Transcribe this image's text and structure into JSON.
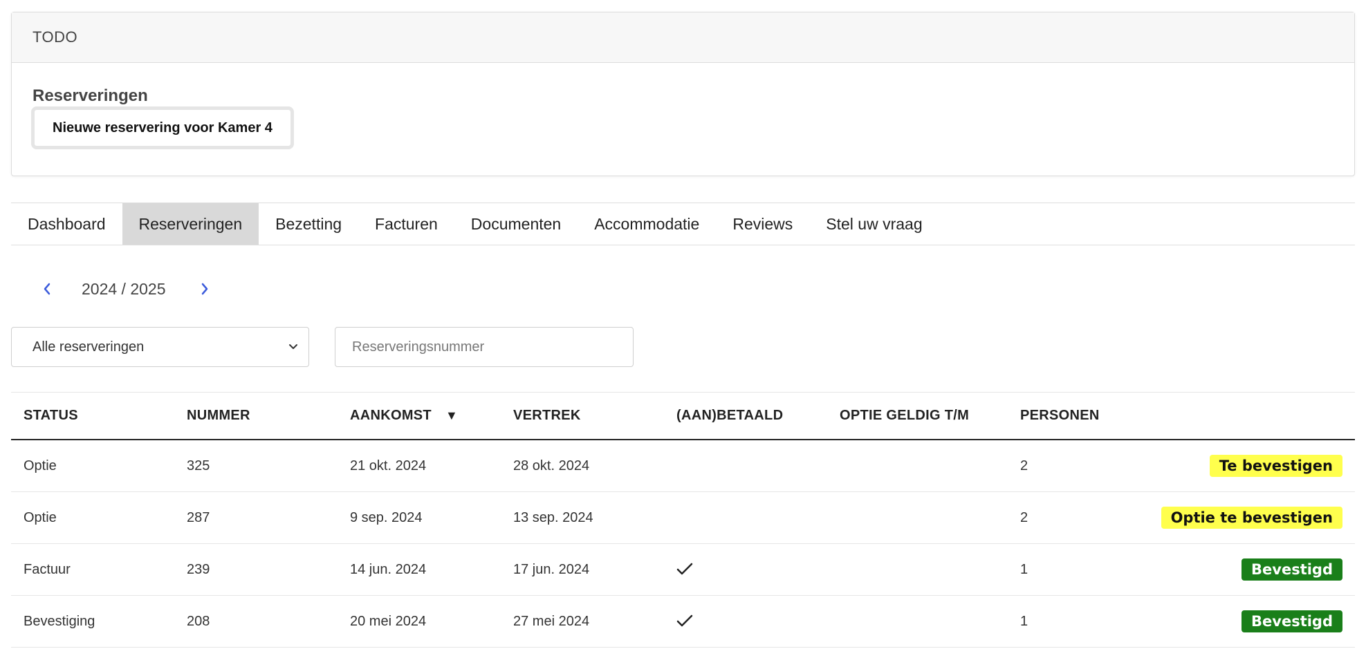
{
  "todo": {
    "header": "TODO",
    "section_title": "Reserveringen",
    "item_label": "Nieuwe reservering voor Kamer 4"
  },
  "tabs": [
    {
      "label": "Dashboard",
      "active": false
    },
    {
      "label": "Reserveringen",
      "active": true
    },
    {
      "label": "Bezetting",
      "active": false
    },
    {
      "label": "Facturen",
      "active": false
    },
    {
      "label": "Documenten",
      "active": false
    },
    {
      "label": "Accommodatie",
      "active": false
    },
    {
      "label": "Reviews",
      "active": false
    },
    {
      "label": "Stel uw vraag",
      "active": false
    }
  ],
  "year_nav": {
    "label": "2024 / 2025",
    "accent_color": "#3b5bdb"
  },
  "filter": {
    "selected": "Alle reserveringen"
  },
  "search": {
    "placeholder": "Reserveringsnummer",
    "value": ""
  },
  "table": {
    "headers": {
      "status": "STATUS",
      "nummer": "NUMMER",
      "aankomst": "AANKOMST",
      "vertrek": "VERTREK",
      "betaald": "(AAN)BETAALD",
      "optie": "OPTIE GELDIG T/M",
      "personen": "PERSONEN"
    },
    "sort_indicator": "▼",
    "rows": [
      {
        "status": "Optie",
        "nummer": "325",
        "aankomst": "21 okt. 2024",
        "vertrek": "28 okt. 2024",
        "paid": false,
        "optie": "",
        "personen": "2",
        "badge": "Te bevestigen",
        "badge_color": "#ffff4d"
      },
      {
        "status": "Optie",
        "nummer": "287",
        "aankomst": "9 sep. 2024",
        "vertrek": "13 sep. 2024",
        "paid": false,
        "optie": "",
        "personen": "2",
        "badge": "Optie te bevestigen",
        "badge_color": "#ffff4d"
      },
      {
        "status": "Factuur",
        "nummer": "239",
        "aankomst": "14 jun. 2024",
        "vertrek": "17 jun. 2024",
        "paid": true,
        "optie": "",
        "personen": "1",
        "badge": "Bevestigd",
        "badge_color": "#1a7f1a"
      },
      {
        "status": "Bevestiging",
        "nummer": "208",
        "aankomst": "20 mei 2024",
        "vertrek": "27 mei 2024",
        "paid": true,
        "optie": "",
        "personen": "1",
        "badge": "Bevestigd",
        "badge_color": "#1a7f1a"
      }
    ]
  }
}
